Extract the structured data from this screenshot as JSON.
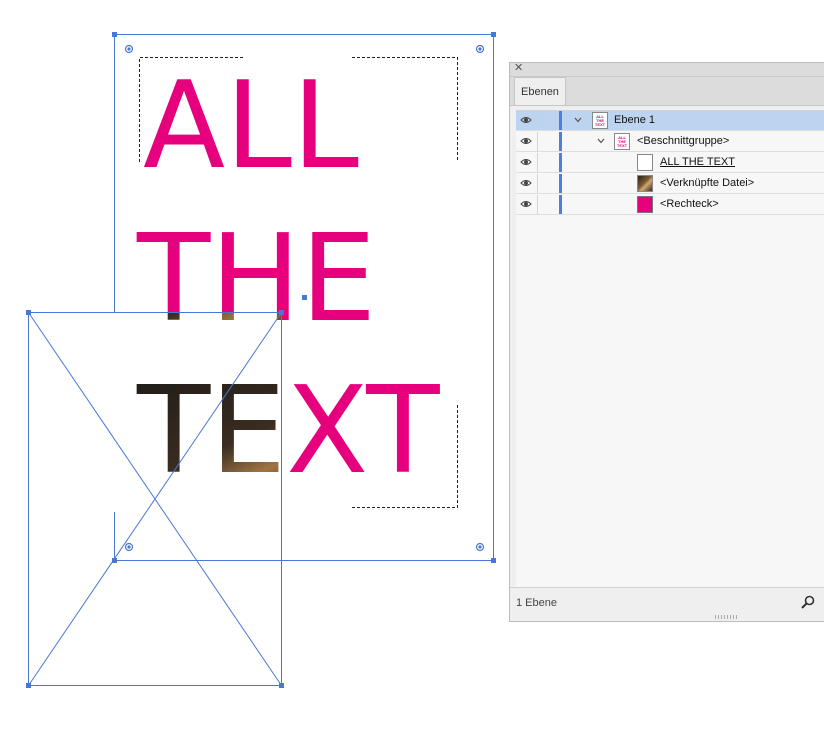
{
  "artboard": {
    "text_lines": [
      "ALL",
      "THE",
      "TEXT"
    ],
    "text_color": "#e6007e",
    "selection_color": "#4a78d0"
  },
  "layers_panel": {
    "tab_label": "Ebenen",
    "close_icon": "close-icon",
    "rows": [
      {
        "label": "Ebene 1",
        "thumb": "text-thumbnail",
        "thumb_text": "ALL THE TEXT",
        "selected": true,
        "expanded": true,
        "underline": false
      },
      {
        "label": "<Beschnittgruppe>",
        "thumb": "text-thumbnail",
        "thumb_text": "ALL THE TEXT",
        "selected": false,
        "expanded": true,
        "underline": false
      },
      {
        "label": "ALL  THE  TEXT",
        "thumb": "empty-thumbnail",
        "selected": false,
        "underline": true
      },
      {
        "label": "<Verknüpfte Datei>",
        "thumb": "image-thumbnail",
        "selected": false,
        "underline": false
      },
      {
        "label": "<Rechteck>",
        "thumb": "pink-thumbnail",
        "selected": false,
        "underline": false
      }
    ],
    "footer": {
      "count_text": "1 Ebene",
      "search_icon": "magnifier-icon"
    },
    "accent_color": "#4d7fe0",
    "selected_row_color": "#bcd4ef"
  }
}
